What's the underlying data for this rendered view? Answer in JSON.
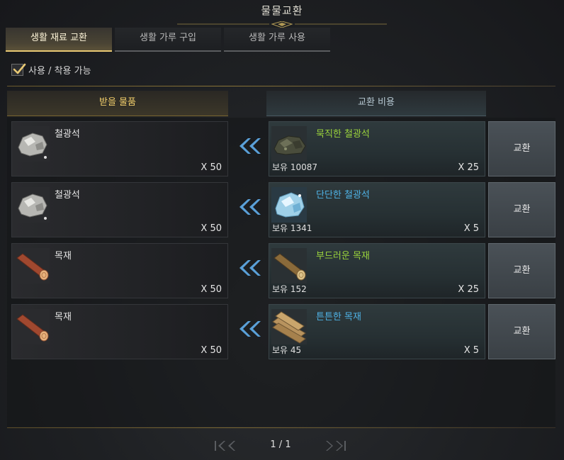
{
  "window": {
    "title": "물물교환"
  },
  "tabs": [
    {
      "label": "생활 재료 교환",
      "active": true
    },
    {
      "label": "생활 가루 구입",
      "active": false
    },
    {
      "label": "생활 가루 사용",
      "active": false
    }
  ],
  "filter": {
    "label": "사용 / 착용 가능",
    "checked": true
  },
  "columns": {
    "receive": "받을 물품",
    "cost": "교환 비용"
  },
  "rows": [
    {
      "receive": {
        "name": "철광석",
        "qty": "X 50",
        "icon": "iron-ore-icon"
      },
      "cost": {
        "name": "묵직한 철광석",
        "owned": "보유 10087",
        "qty": "X 25",
        "icon": "heavy-iron-ore-icon",
        "color": "#9bd43c"
      },
      "button": "교환"
    },
    {
      "receive": {
        "name": "철광석",
        "qty": "X 50",
        "icon": "iron-ore-icon"
      },
      "cost": {
        "name": "단단한 철광석",
        "owned": "보유 1341",
        "qty": "X 5",
        "icon": "hard-iron-ore-icon",
        "color": "#4fb3e6"
      },
      "button": "교환"
    },
    {
      "receive": {
        "name": "목재",
        "qty": "X 50",
        "icon": "timber-icon"
      },
      "cost": {
        "name": "부드러운 목재",
        "owned": "보유 152",
        "qty": "X 25",
        "icon": "soft-timber-icon",
        "color": "#9bd43c"
      },
      "button": "교환"
    },
    {
      "receive": {
        "name": "목재",
        "qty": "X 50",
        "icon": "timber-icon"
      },
      "cost": {
        "name": "튼튼한 목재",
        "owned": "보유 45",
        "qty": "X 5",
        "icon": "sturdy-plank-icon",
        "color": "#4fb3e6"
      },
      "button": "교환"
    }
  ],
  "pagination": {
    "indicator": "1 / 1"
  },
  "colors": {
    "accent_gold": "#e8c873",
    "uncommon_green": "#9bd43c",
    "rare_blue": "#4fb3e6",
    "arrow_blue": "#5aa0d8"
  }
}
